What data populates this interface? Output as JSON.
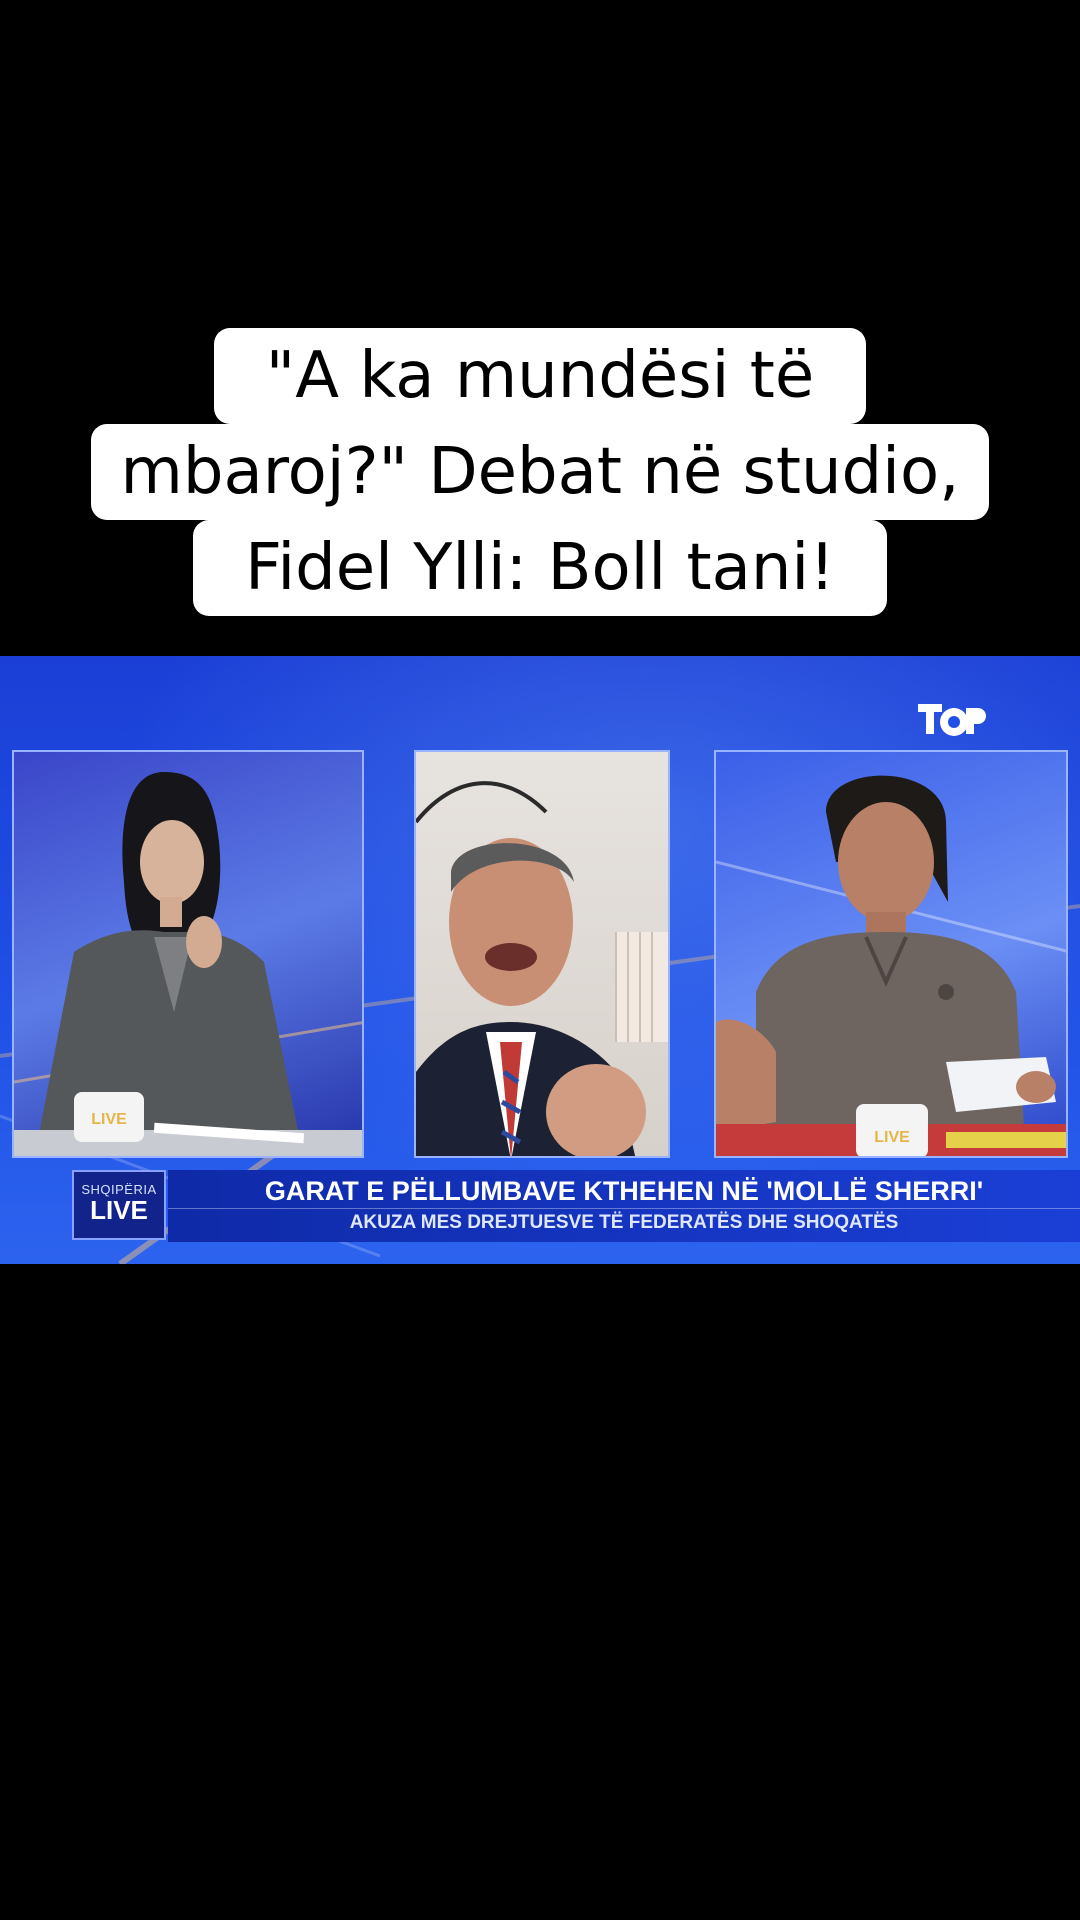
{
  "caption": {
    "line1": "\"A ka mundësi të",
    "line2": "mbaroj?\" Debat në studio,",
    "line3": "Fidel Ylli: Boll tani!"
  },
  "broadcast": {
    "channel_logo_icon": "top-channel-logo-icon",
    "show_label_small": "SHQIPËRIA",
    "show_label_big": "LIVE",
    "mug_label": "LIVE",
    "headline": "GARAT E PËLLUMBAVE KTHEHEN NË 'MOLLË SHERRI'",
    "subheadline": "AKUZA MES DREJTUESVE TË FEDERATËS DHE SHOQATËS"
  },
  "colors": {
    "background": "#000000",
    "caption_bg": "#ffffff",
    "studio_blue": "#1f4fe6",
    "ticker_blue": "#0f2aa8"
  }
}
